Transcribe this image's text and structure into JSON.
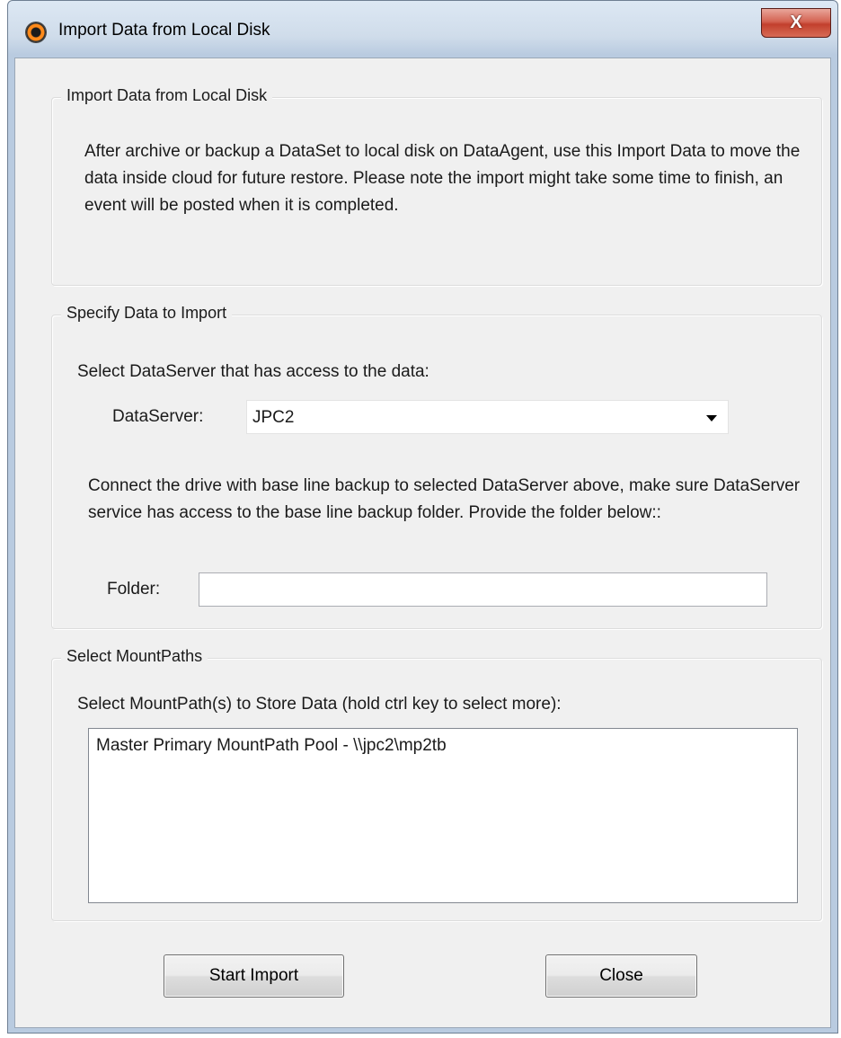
{
  "window": {
    "title": "Import Data from Local Disk",
    "close_glyph": "X",
    "app_icon": "app-logo-icon"
  },
  "section_intro": {
    "label": "Import Data from Local Disk",
    "description": "After archive or backup a DataSet to local disk on DataAgent, use this Import Data to move the data inside cloud for future restore. Please note the import might take some time to finish, an event will be posted when it is completed."
  },
  "section_specify": {
    "label": "Specify Data to Import",
    "select_server_prompt": "Select DataServer that has access to the data:",
    "dataserver_label": "DataServer:",
    "dataserver_value": "JPC2",
    "instructions": "Connect the drive with base line backup to selected DataServer above, make sure DataServer service has access to the base line backup folder. Provide the folder below::",
    "folder_label": "Folder:",
    "folder_value": ""
  },
  "section_mountpaths": {
    "label": "Select MountPaths",
    "prompt": "Select MountPath(s) to Store Data (hold ctrl key to select more):",
    "items": [
      "Master Primary MountPath Pool - \\\\jpc2\\mp2tb"
    ]
  },
  "buttons": {
    "start_import": "Start Import",
    "close": "Close"
  }
}
